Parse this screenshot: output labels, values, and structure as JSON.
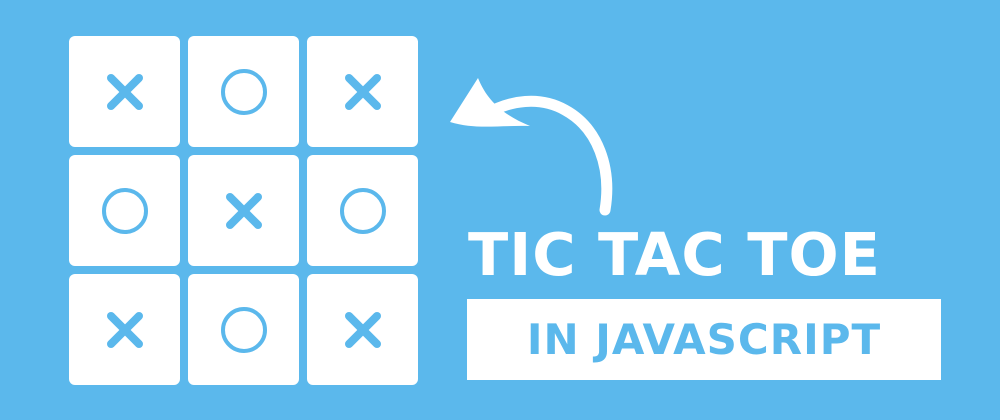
{
  "colors": {
    "background": "#5bb8ec",
    "tile": "#ffffff",
    "mark": "#5bb8ec",
    "text": "#ffffff"
  },
  "board": {
    "cells": [
      "x",
      "o",
      "x",
      "o",
      "x",
      "o",
      "x",
      "o",
      "x"
    ]
  },
  "arrow_icon": "curved-arrow-icon",
  "title": "TIC TAC TOE",
  "subtitle": "IN JAVASCRIPT"
}
